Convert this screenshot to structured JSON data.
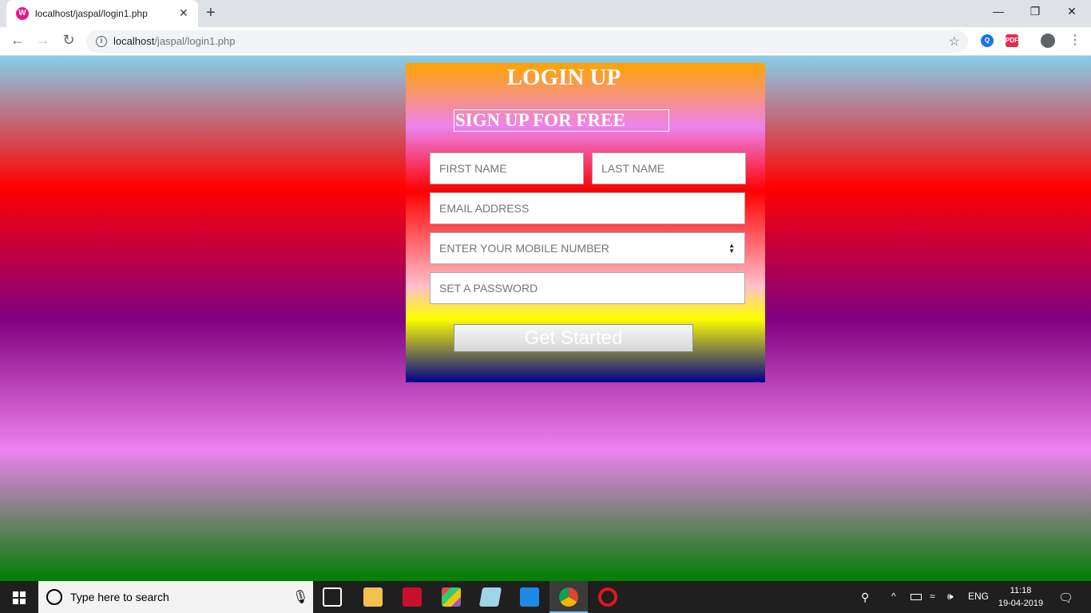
{
  "browser": {
    "tab_title": "localhost/jaspal/login1.php",
    "favicon_letter": "W",
    "close_glyph": "✕",
    "new_tab_glyph": "+",
    "url_host": "localhost",
    "url_path": "/jaspal/login1.php",
    "back_glyph": "←",
    "forward_glyph": "→",
    "reload_glyph": "↻",
    "star_glyph": "☆",
    "menu_glyph": "⋮",
    "minimize_glyph": "—",
    "restore_glyph": "❐",
    "window_close_glyph": "✕",
    "ext_search_label": "Q",
    "ext_pdf_label": "PDF",
    "info_glyph": "i"
  },
  "form": {
    "title": "LOGIN UP",
    "subtitle": "SIGN UP FOR FREE",
    "first_name_placeholder": "FIRST NAME",
    "last_name_placeholder": "LAST NAME",
    "email_placeholder": "EMAIL ADDRESS",
    "mobile_placeholder": "ENTER YOUR MOBILE NUMBER",
    "password_placeholder": "SET A PASSWORD",
    "spinner_up": "▲",
    "spinner_down": "▼",
    "submit_label": "Get Started"
  },
  "taskbar": {
    "search_placeholder": "Type here to search",
    "mic_glyph": "🎙",
    "language": "ENG",
    "time": "11:18",
    "date": "19-04-2019",
    "tray_chevron": "^",
    "notification_glyph": "🗨"
  },
  "colors": {
    "page_gradient": [
      "#87ceeb",
      "#ff0000",
      "#800080",
      "#ee82ee",
      "#008000"
    ],
    "card_gradient": [
      "#ffa500",
      "#ee82ee",
      "#ff0000",
      "#ffc0cb",
      "#ffff00",
      "#00008b"
    ]
  }
}
